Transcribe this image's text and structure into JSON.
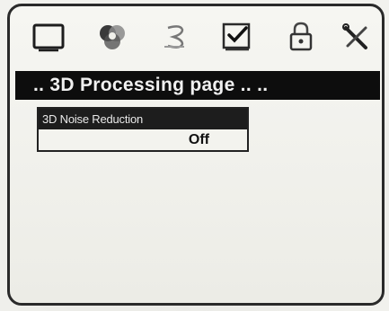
{
  "title_bar": {
    "text": ".. 3D Processing page .. .."
  },
  "setting": {
    "label": "3D Noise Reduction",
    "value": "Off"
  },
  "toolbar": {
    "icons": [
      "screen-icon",
      "colors-icon",
      "sound-icon",
      "setup-icon",
      "lock-icon",
      "tools-icon"
    ]
  },
  "colors": {
    "bezel": "#2a2a2a",
    "title_bg": "#0d0d0d",
    "title_fg": "#f0f0f0",
    "screen_bg": "#f4f4f0"
  }
}
